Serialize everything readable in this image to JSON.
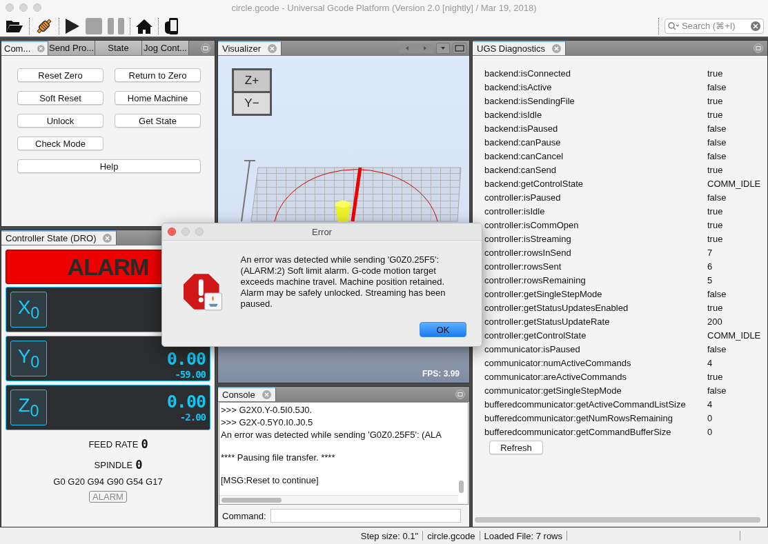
{
  "window": {
    "title": "circle.gcode - Universal Gcode Platform (Version 2.0 [nightly]  / Mar 19, 2018)"
  },
  "toolbar": [
    {
      "kind": "open",
      "disabled": false
    },
    {
      "kind": "connect",
      "disabled": false
    },
    {
      "kind": "play",
      "disabled": false
    },
    {
      "kind": "stop",
      "disabled": true
    },
    {
      "kind": "pause",
      "disabled": true
    },
    {
      "kind": "home",
      "disabled": false
    },
    {
      "kind": "pendant",
      "disabled": false
    }
  ],
  "search": {
    "placeholder": "Search (⌘+I)"
  },
  "commands_panel": {
    "tabs": [
      {
        "label": "Com...",
        "selected": true
      },
      {
        "label": "Send Pro...",
        "selected": false
      },
      {
        "label": "State",
        "selected": false
      },
      {
        "label": "Jog Cont...",
        "selected": false
      }
    ],
    "buttons": [
      {
        "label": "Reset Zero",
        "kind": "normal"
      },
      {
        "label": "Return to Zero",
        "kind": "normal"
      },
      {
        "label": "Soft Reset",
        "kind": "normal"
      },
      {
        "label": "Home Machine",
        "kind": "normal"
      },
      {
        "label": "Unlock",
        "kind": "normal"
      },
      {
        "label": "Get State",
        "kind": "normal"
      },
      {
        "label": "Check Mode",
        "kind": "normal"
      },
      {
        "label": "Help",
        "kind": "wide"
      }
    ]
  },
  "dro": {
    "tab": "Controller State (DRO)",
    "state": "ALARM",
    "axes": [
      {
        "label": "X$_{0}$"
      },
      {
        "label": "Y$_{0}$",
        "work": "0.00",
        "machine": "-59.00"
      },
      {
        "label": "Z$_{0}$",
        "work": "0.00",
        "machine": "-2.00"
      }
    ],
    "feed_label": "FEED RATE",
    "feed": "0",
    "spindle_label": "SPINDLE",
    "spindle": "0",
    "gcodes": "G0 G20 G94 G90 G54 G17",
    "badge": "ALARM"
  },
  "visualizer": {
    "tab": "Visualizer",
    "cube_top": "Z+",
    "cube_front": "Y−",
    "fps": "FPS: 3.99"
  },
  "console": {
    "tab": "Console",
    "blocks": [
      [
        ">>> G2X0.Y-0.5I0.5J0.",
        ">>> G2X-0.5Y0.I0.J0.5",
        "An error was detected while sending 'G0Z0.25F5': (ALA"
      ],
      [
        "**** Pausing file transfer. ****"
      ],
      [
        "[MSG:Reset to continue]"
      ]
    ],
    "command_label": "Command:"
  },
  "diagnostics": {
    "tab": "UGS Diagnostics",
    "rows": [
      {
        "key": "backend:isConnected",
        "value": "true"
      },
      {
        "key": "backend:isActive",
        "value": "false"
      },
      {
        "key": "backend:isSendingFile",
        "value": "true"
      },
      {
        "key": "backend:isIdle",
        "value": "true"
      },
      {
        "key": "backend:isPaused",
        "value": "false"
      },
      {
        "key": "backend:canPause",
        "value": "false"
      },
      {
        "key": "backend:canCancel",
        "value": "false"
      },
      {
        "key": "backend:canSend",
        "value": "true"
      },
      {
        "key": "backend:getControlState",
        "value": "COMM_IDLE"
      },
      {
        "key": "controller:isPaused",
        "value": "false"
      },
      {
        "key": "controller:isIdle",
        "value": "true"
      },
      {
        "key": "controller:isCommOpen",
        "value": "true"
      },
      {
        "key": "controller:isStreaming",
        "value": "true"
      },
      {
        "key": "controller:rowsInSend",
        "value": "7"
      },
      {
        "key": "controller:rowsSent",
        "value": "6"
      },
      {
        "key": "controller:rowsRemaining",
        "value": "5"
      },
      {
        "key": "controller:getSingleStepMode",
        "value": "false"
      },
      {
        "key": "controller:getStatusUpdatesEnabled",
        "value": "true"
      },
      {
        "key": "controller:getStatusUpdateRate",
        "value": "200"
      },
      {
        "key": "controller:getControlState",
        "value": "COMM_IDLE"
      },
      {
        "key": "communicator:isPaused",
        "value": "false"
      },
      {
        "key": "communicator:numActiveCommands",
        "value": "4"
      },
      {
        "key": "communicator:areActiveCommands",
        "value": "true"
      },
      {
        "key": "communicator:getSingleStepMode",
        "value": "false"
      },
      {
        "key": "bufferedcommunicator:getActiveCommandListSize",
        "value": "4"
      },
      {
        "key": "bufferedcommunicator:getNumRowsRemaining",
        "value": "0"
      },
      {
        "key": "bufferedcommunicator:getCommandBufferSize",
        "value": "0"
      }
    ],
    "refresh": "Refresh"
  },
  "status_bar": [
    "Step size: 0.1\"",
    "circle.gcode",
    "Loaded File: 7 rows"
  ],
  "dialog": {
    "title": "Error",
    "message": "An error was detected while sending 'G0Z0.25F5': (ALARM:2) Soft limit alarm. G-code motion target exceeds machine travel. Machine position retained. Alarm may be safely unlocked. Streaming has been paused.",
    "button": "OK"
  }
}
